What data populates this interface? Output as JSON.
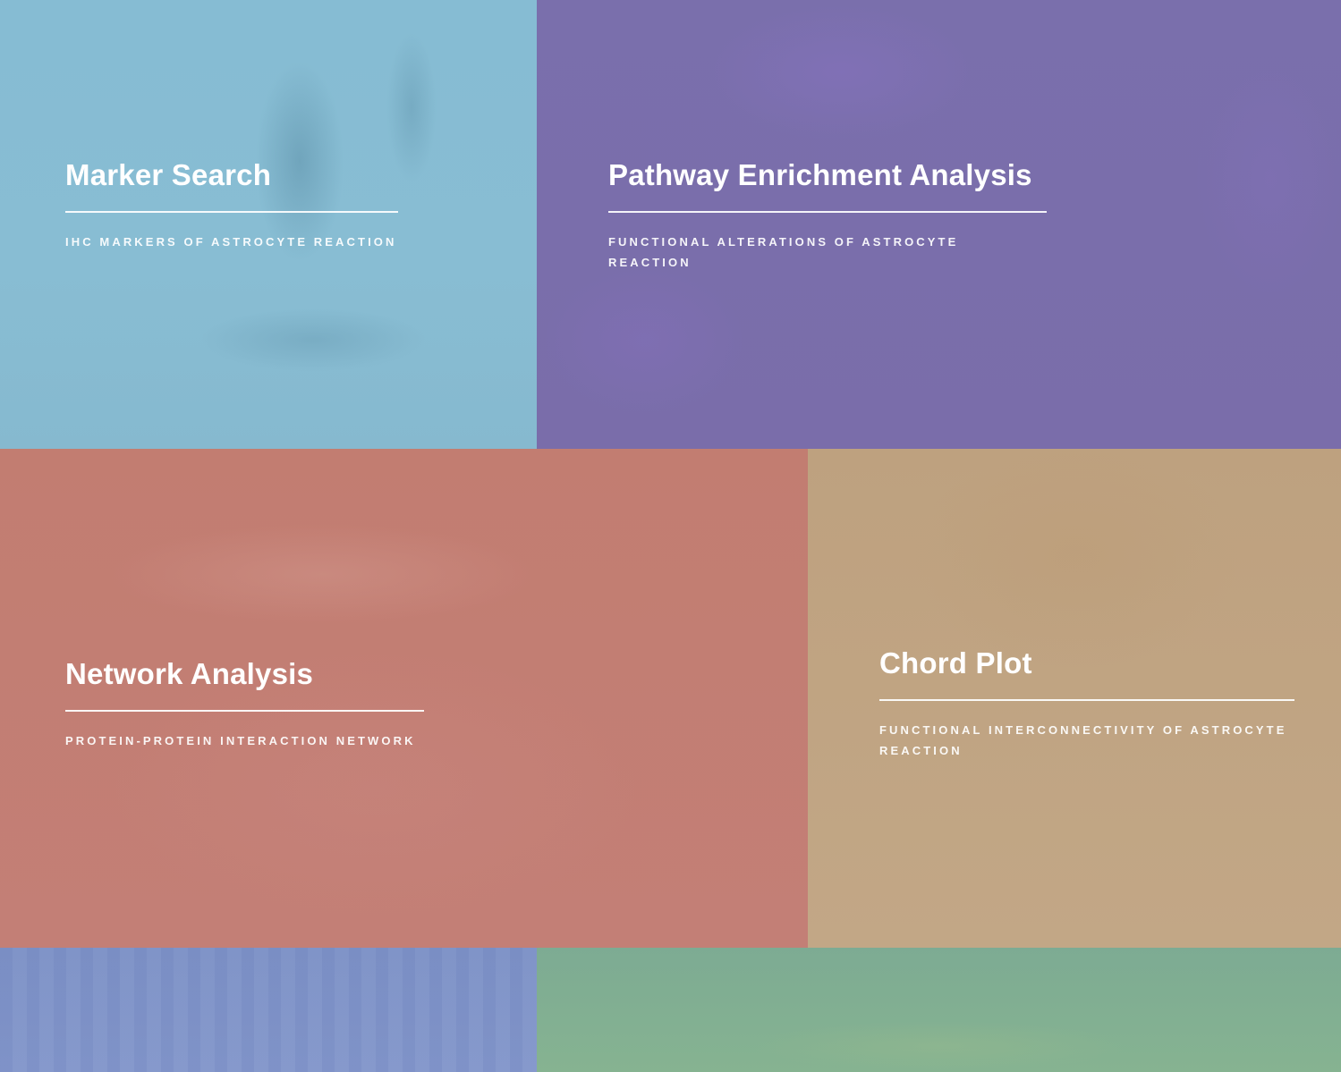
{
  "tiles": [
    {
      "title": "Marker Search",
      "subtitle": "IHC MARKERS OF ASTROCYTE REACTION",
      "color": "#88bcd2"
    },
    {
      "title": "Pathway Enrichment Analysis",
      "subtitle": "FUNCTIONAL ALTERATIONS OF ASTROCYTE REACTION",
      "color": "#7a6eab"
    },
    {
      "title": "Network Analysis",
      "subtitle": "PROTEIN-PROTEIN INTERACTION NETWORK",
      "color": "#c27e73"
    },
    {
      "title": "Chord Plot",
      "subtitle": "FUNCTIONAL INTERCONNECTIVITY OF ASTROCYTE REACTION",
      "color": "#c0a482"
    },
    {
      "color": "#8196c8"
    },
    {
      "color": "#80ae92"
    }
  ]
}
